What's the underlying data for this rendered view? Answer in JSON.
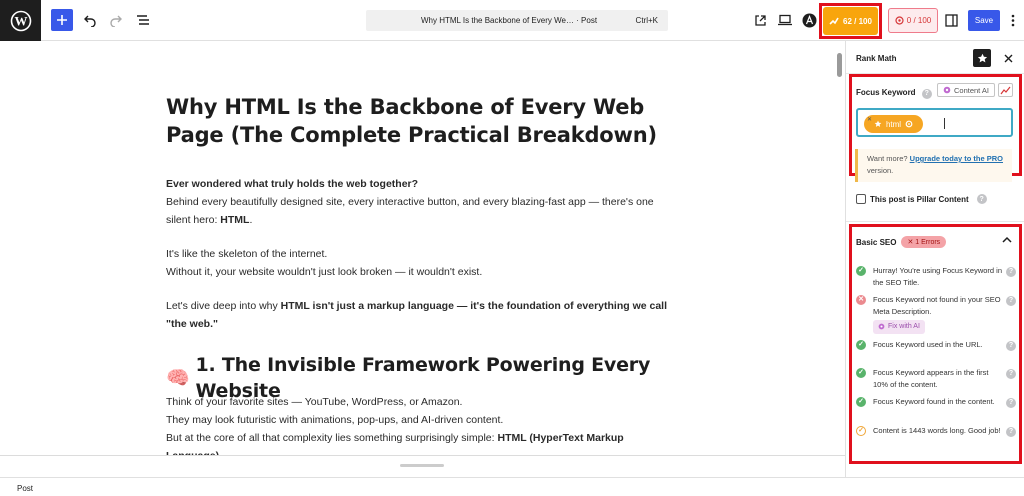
{
  "topbar": {
    "command_title": "Why HTML Is the Backbone of Every We… · Post",
    "command_shortcut": "Ctrl+K",
    "rankmath_score": "62 / 100",
    "content_ai_score": "0 / 100",
    "save_label": "Save"
  },
  "post": {
    "title": "Why HTML Is the Backbone of Every Web Page (The Complete Practical Breakdown)",
    "intro_bold": "Ever wondered what truly holds the web together?",
    "intro_text": "Behind every beautifully designed site, every interactive button, and every blazing-fast app — there's one silent hero: ",
    "intro_hero": "HTML",
    "intro_end": ".",
    "skeleton_line1": "It's like the skeleton of the internet.",
    "skeleton_line2": "Without it, your website wouldn't just look broken — it wouldn't exist.",
    "dive_text": "Let's dive deep into why ",
    "dive_bold": "HTML isn't just a markup language — it's the foundation of everything we call \"the web.\"",
    "h2_emoji": "🧠",
    "h2": "1. The Invisible Framework Powering Every Website",
    "fav_line1": "Think of your favorite sites — YouTube, WordPress, or Amazon.",
    "fav_line2": "They may look futuristic with animations, pop-ups, and AI-driven content.",
    "fav_line3_text": "But at the core of all that complexity lies something surprisingly simple: ",
    "fav_line3_bold": "HTML (HyperText Markup Language)"
  },
  "footer": {
    "breadcrumb": "Post"
  },
  "sidebar": {
    "title": "Rank Math",
    "focus_keyword_label": "Focus Keyword",
    "content_ai_button": "Content AI",
    "keyword": "html",
    "notice_text": "Want more? ",
    "notice_link": "Upgrade today to the PRO",
    "notice_end": " version.",
    "pillar_label": "This post is Pillar Content",
    "basic_seo_label": "Basic SEO",
    "errors_badge": "✕ 1 Errors",
    "fix_ai_label": "Fix with AI",
    "checks": [
      {
        "status": "ok",
        "text": "Hurray! You're using Focus Keyword in the SEO Title."
      },
      {
        "status": "bad",
        "text": "Focus Keyword not found in your SEO Meta Description."
      },
      {
        "status": "ok",
        "text": "Focus Keyword used in the URL."
      },
      {
        "status": "ok",
        "text": "Focus Keyword appears in the first 10% of the content."
      },
      {
        "status": "ok",
        "text": "Focus Keyword found in the content."
      },
      {
        "status": "warn",
        "text": "Content is 1443 words long. Good job!"
      }
    ]
  },
  "colors": {
    "accent": "#3858e9",
    "score_good": "#f8a50d",
    "highlight_frame": "#e0101d",
    "ok": "#59b36b",
    "error": "#eb8a8f"
  }
}
